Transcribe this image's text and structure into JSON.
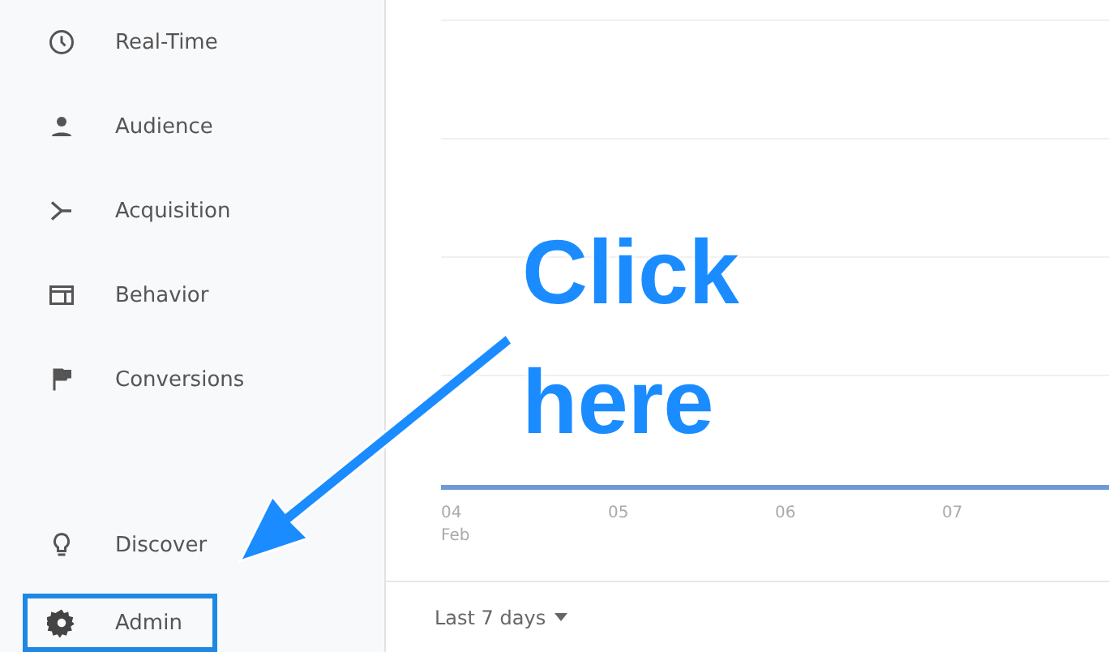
{
  "sidebar": {
    "items": [
      {
        "label": "Real-Time",
        "highlighted": false
      },
      {
        "label": "Audience",
        "highlighted": false
      },
      {
        "label": "Acquisition",
        "highlighted": false
      },
      {
        "label": "Behavior",
        "highlighted": false
      },
      {
        "label": "Conversions",
        "highlighted": false
      },
      {
        "label": "Discover",
        "highlighted": false
      },
      {
        "label": "Admin",
        "highlighted": true
      }
    ]
  },
  "chart": {
    "x_labels": [
      {
        "day": "04",
        "month": "Feb"
      },
      {
        "day": "05"
      },
      {
        "day": "06"
      },
      {
        "day": "07"
      }
    ]
  },
  "date_range": {
    "label": "Last 7 days"
  },
  "annotation": {
    "lines": [
      "Click",
      "here"
    ]
  }
}
